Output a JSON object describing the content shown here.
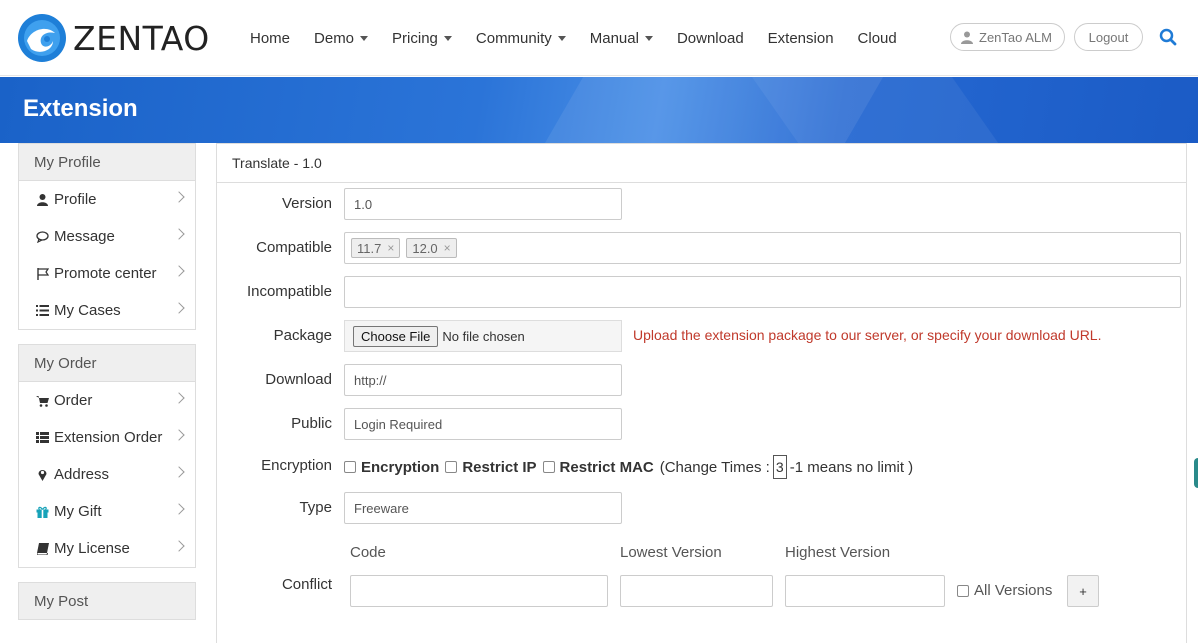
{
  "brand": {
    "name": "ZENTAO"
  },
  "nav": {
    "items": [
      {
        "label": "Home",
        "dropdown": false
      },
      {
        "label": "Demo",
        "dropdown": true
      },
      {
        "label": "Pricing",
        "dropdown": true
      },
      {
        "label": "Community",
        "dropdown": true
      },
      {
        "label": "Manual",
        "dropdown": true
      },
      {
        "label": "Download",
        "dropdown": false
      },
      {
        "label": "Extension",
        "dropdown": false
      },
      {
        "label": "Cloud",
        "dropdown": false
      }
    ],
    "alm_label": "ZenTao ALM",
    "logout_label": "Logout"
  },
  "banner": {
    "title": "Extension"
  },
  "sidebar": {
    "groups": [
      {
        "title": "My Profile",
        "items": [
          {
            "label": "Profile",
            "icon": "user-icon"
          },
          {
            "label": "Message",
            "icon": "comments-icon"
          },
          {
            "label": "Promote center",
            "icon": "flag-icon"
          },
          {
            "label": "My Cases",
            "icon": "list-icon"
          }
        ]
      },
      {
        "title": "My Order",
        "items": [
          {
            "label": "Order",
            "icon": "cart-icon"
          },
          {
            "label": "Extension Order",
            "icon": "th-list-icon"
          },
          {
            "label": "Address",
            "icon": "map-marker-icon"
          },
          {
            "label": "My Gift",
            "icon": "gift-icon"
          },
          {
            "label": "My License",
            "icon": "book-icon"
          }
        ]
      },
      {
        "title": "My Post",
        "items": []
      }
    ]
  },
  "form": {
    "header": "Translate - 1.0",
    "version": {
      "label": "Version",
      "value": "1.0"
    },
    "compatible": {
      "label": "Compatible",
      "tags": [
        "11.7",
        "12.0"
      ]
    },
    "incompatible": {
      "label": "Incompatible",
      "value": ""
    },
    "package": {
      "label": "Package",
      "button": "Choose File",
      "status": "No file chosen",
      "hint": "Upload the extension package to our server, or specify your download URL."
    },
    "download": {
      "label": "Download",
      "value": "http://"
    },
    "public": {
      "label": "Public",
      "value": "Login Required"
    },
    "encryption": {
      "label": "Encryption",
      "opt1": "Encryption",
      "opt2": "Restrict IP",
      "opt3": "Restrict MAC",
      "change_prefix": "(Change Times :",
      "change_value": "3",
      "change_suffix": "-1 means no limit )"
    },
    "type": {
      "label": "Type",
      "value": "Freeware"
    },
    "conflict": {
      "label": "Conflict",
      "col_code": "Code",
      "col_lowest": "Lowest Version",
      "col_highest": "Highest Version",
      "all_versions": "All Versions",
      "add_button": "+"
    }
  },
  "colors": {
    "accent": "#1f6fd6",
    "hint": "#c0392b",
    "gift": "#17a2b8"
  }
}
